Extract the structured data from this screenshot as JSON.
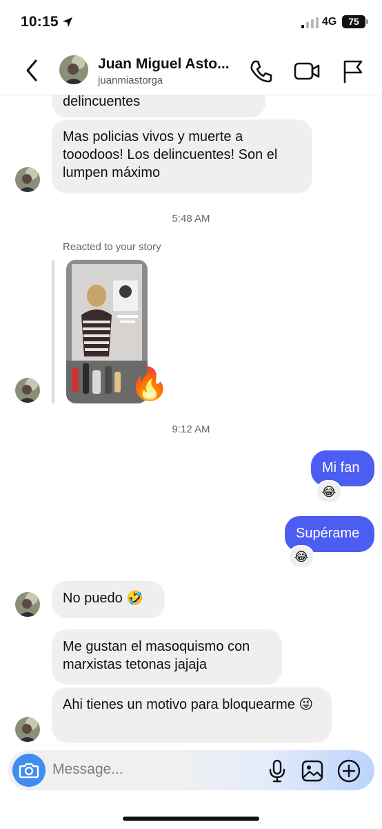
{
  "status_bar": {
    "time": "10:15",
    "network": "4G",
    "battery": "75"
  },
  "header": {
    "name": "Juan Miguel Asto...",
    "username": "juanmiastorga"
  },
  "messages": [
    {
      "from": "them",
      "text": "delincuentes"
    },
    {
      "from": "them",
      "text": "Mas policias vivos y muerte a tooodoos! Los delincuentes! Son el lumpen máximo"
    },
    {
      "type": "timestamp",
      "text": "5:48 AM"
    },
    {
      "from": "them",
      "type": "story_reaction",
      "label": "Reacted to your story",
      "reaction": "🔥"
    },
    {
      "type": "timestamp",
      "text": "9:12 AM"
    },
    {
      "from": "me",
      "text": "Mi fan",
      "reaction": "😂"
    },
    {
      "from": "me",
      "text": "Supérame",
      "reaction": "😂"
    },
    {
      "from": "them",
      "text": "No puedo 🤣"
    },
    {
      "from": "them",
      "text": "Me gustan el masoquismo con marxistas tetonas jajaja"
    },
    {
      "from": "them",
      "text": "Ahi tienes un motivo para bloquearme 😜"
    }
  ],
  "composer": {
    "placeholder": "Message..."
  },
  "icons": {
    "back": "chevron-left-icon",
    "call": "phone-icon",
    "video": "video-camera-icon",
    "report": "flag-icon",
    "camera": "camera-icon",
    "mic": "microphone-icon",
    "gallery": "image-icon",
    "add": "plus-circle-icon"
  },
  "colors": {
    "outgoing_bubble": "#4c5df2",
    "incoming_bubble": "#efefef",
    "camera_button": "#3f8cf3"
  }
}
